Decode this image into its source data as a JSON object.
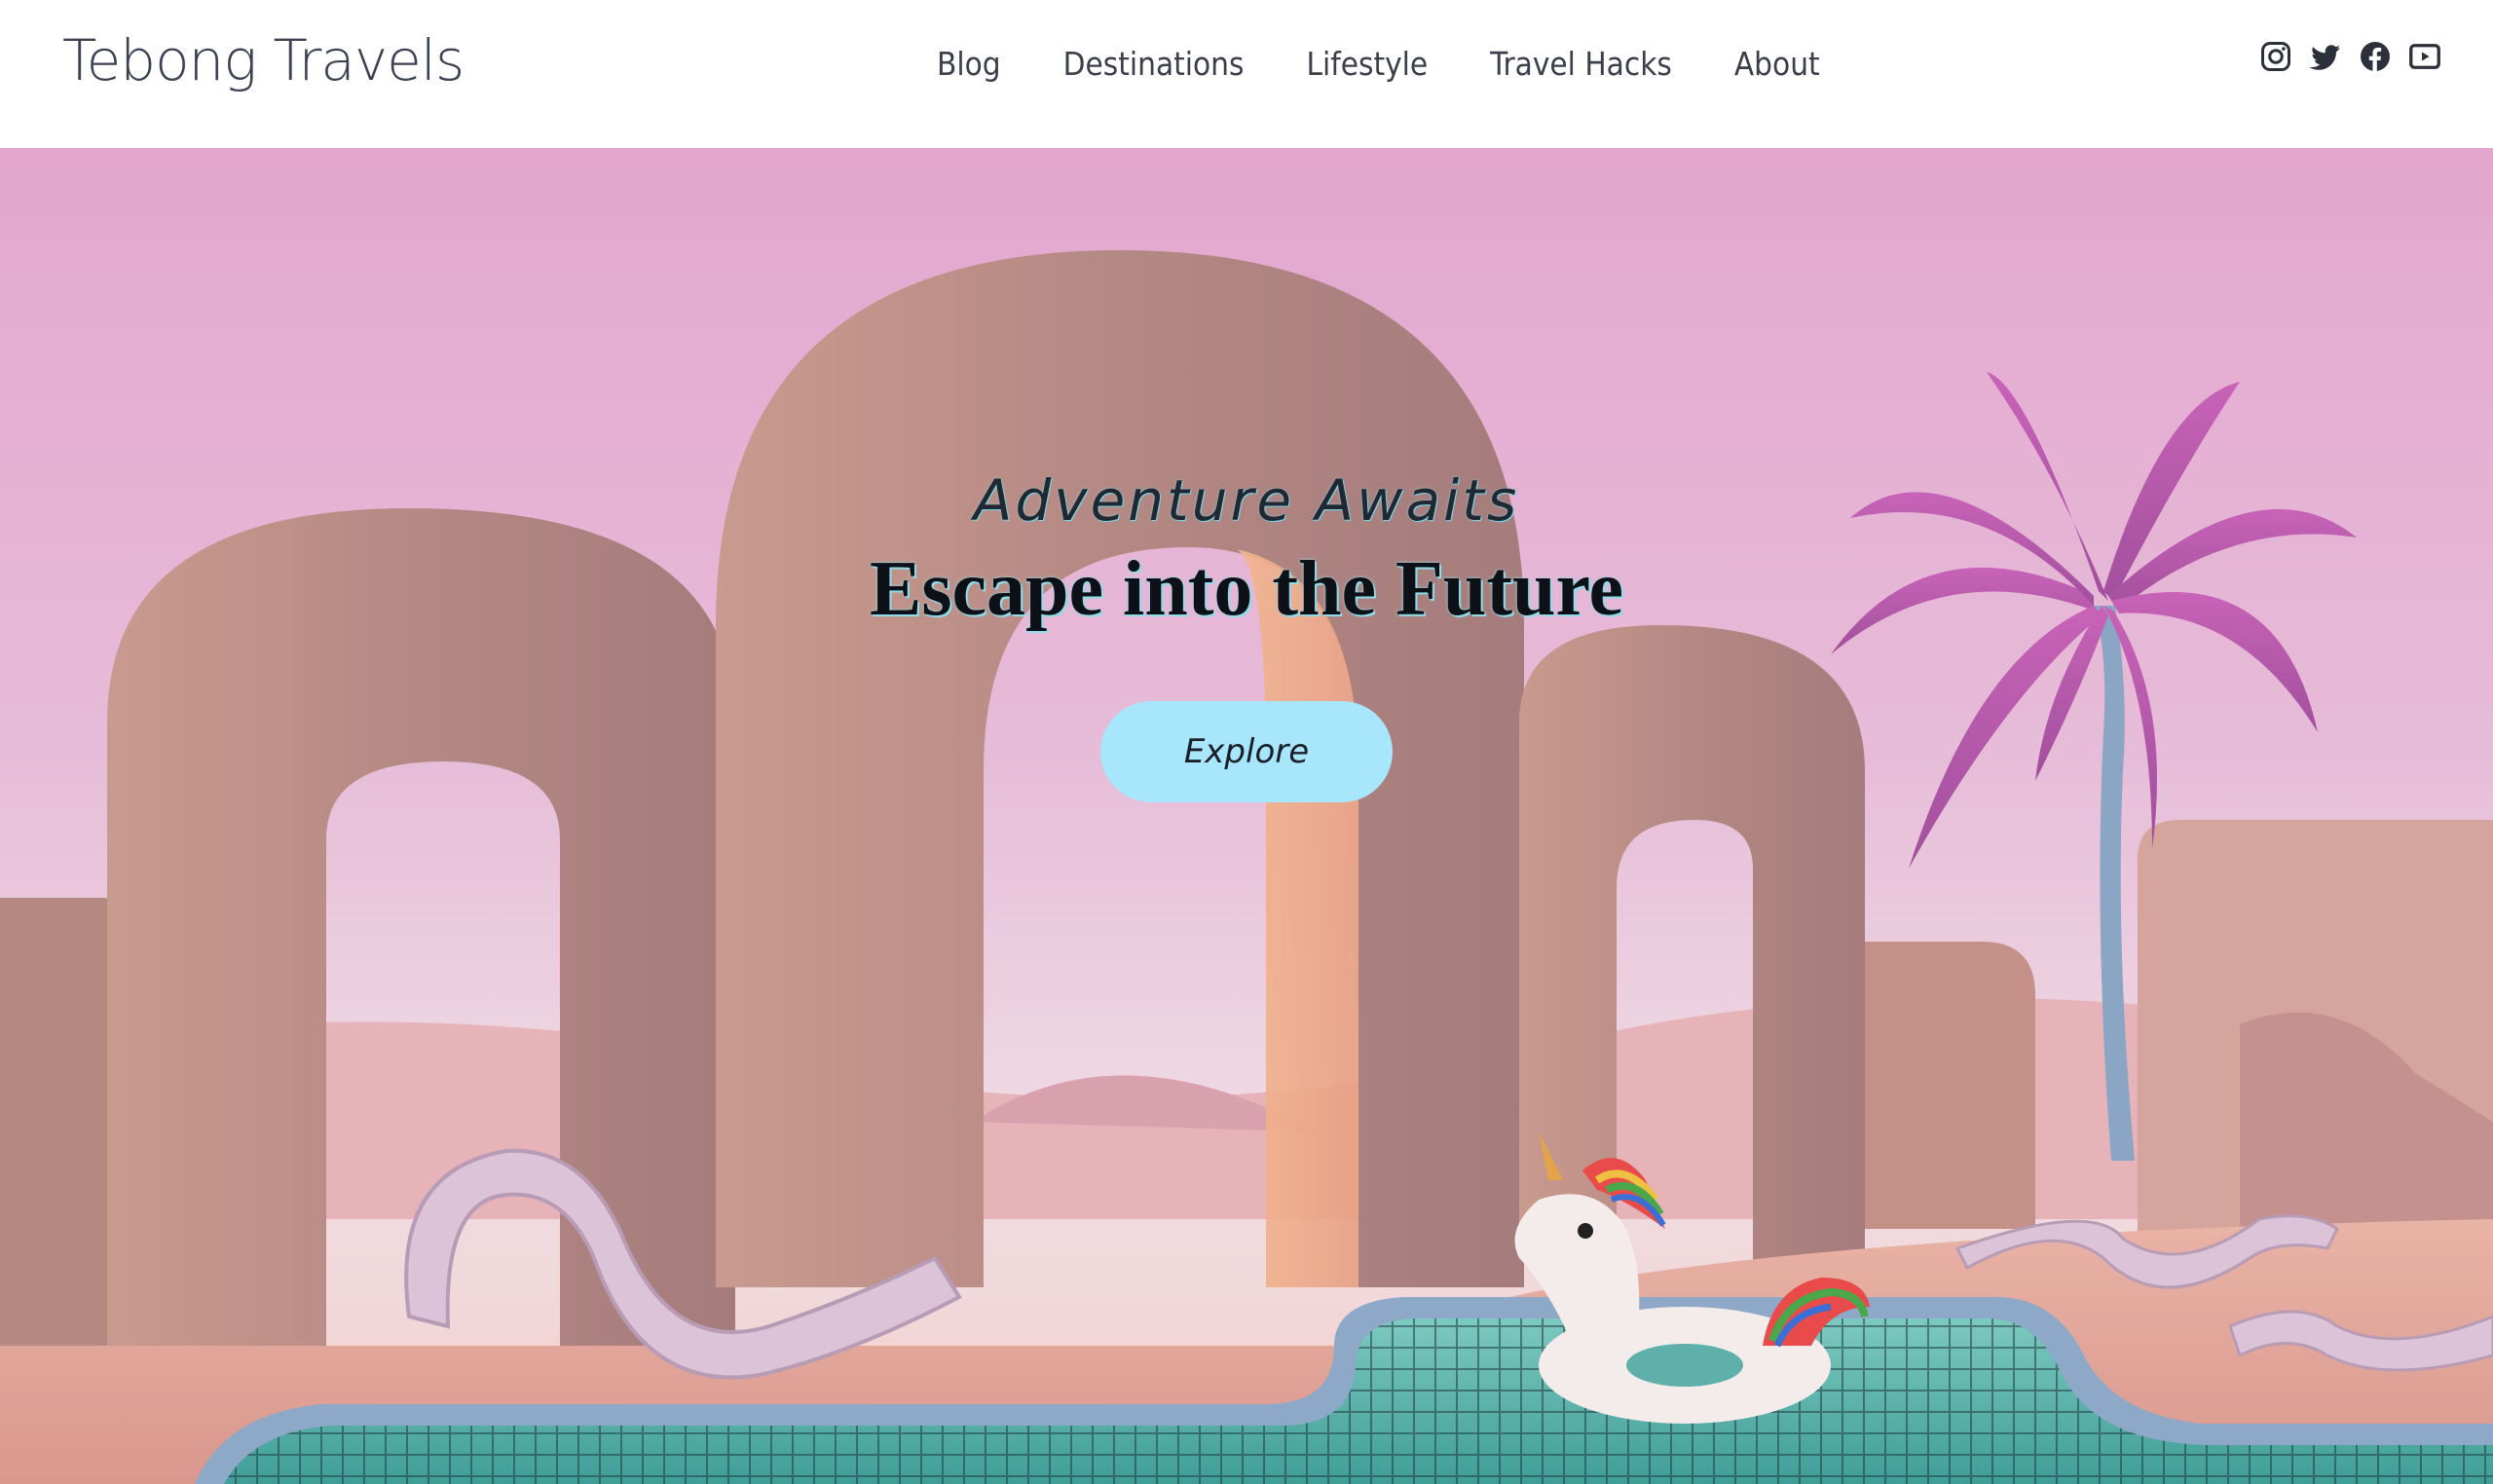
{
  "header": {
    "logo": "Tebong Travels",
    "nav": [
      "Blog",
      "Destinations",
      "Lifestyle",
      "Travel Hacks",
      "About"
    ],
    "social_icons": [
      "instagram-icon",
      "twitter-icon",
      "facebook-icon",
      "youtube-icon"
    ]
  },
  "hero": {
    "kicker": "Adventure Awaits",
    "headline": "Escape into the Future",
    "cta_label": "Explore",
    "scene": "pastel pink desert with arches, palm tree, pool and unicorn float"
  },
  "colors": {
    "header_bg": "#ffffff",
    "nav_text": "#3a3f4a",
    "cta_bg": "#a8e6fb",
    "sky_top": "#e4a6cf",
    "arch": "#b98a83",
    "pool": "#5bb8b0"
  }
}
